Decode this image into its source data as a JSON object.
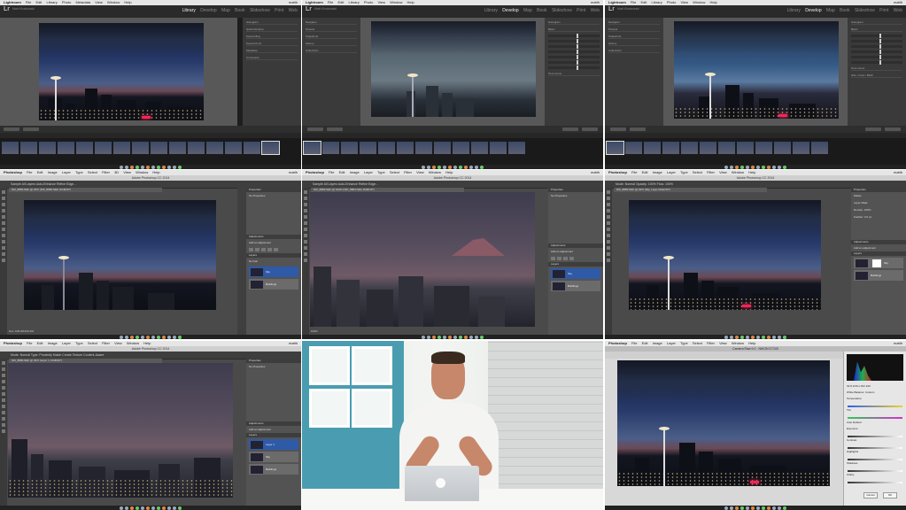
{
  "menubar": {
    "lightroom": {
      "app": "Lightroom",
      "items": [
        "File",
        "Edit",
        "Library",
        "Photo",
        "Metadata",
        "View",
        "Window",
        "Help"
      ]
    },
    "photoshop": {
      "app": "Photoshop",
      "items": [
        "File",
        "Edit",
        "Image",
        "Layer",
        "Type",
        "Select",
        "Filter",
        "3D",
        "View",
        "Window",
        "Help"
      ]
    },
    "clock": "matth"
  },
  "lightroom": {
    "logo": "Lr",
    "identity_plate": "Matt Kloskowski",
    "modules": [
      "Library",
      "Develop",
      "Map",
      "Book",
      "Slideshow",
      "Print",
      "Web"
    ],
    "library_active": "Library",
    "develop_active": "Develop",
    "left_panels": [
      "Navigator",
      "Presets",
      "Snapshots",
      "History",
      "Collections"
    ],
    "right_panels_library": [
      "Histogram",
      "Quick Develop",
      "Keywording",
      "Keyword List",
      "Metadata",
      "Comments"
    ],
    "right_panels_develop": [
      "Histogram",
      "Basic",
      "Tone Curve",
      "HSL / Color / B&W",
      "Split Toning",
      "Detail"
    ],
    "toolbar_buttons": [
      "Copy...",
      "Paste",
      "Previous",
      "Reset"
    ],
    "filmstrip_label": "Filter:"
  },
  "photoshop": {
    "window_title": "Adobe Photoshop CC 2014",
    "options_bar": "Sample All Layers   Auto-Enhance   Refine Edge...",
    "options_bar_2": "Mode: Normal   Opacity: 100%   Flow: 100%",
    "options_bar_3": "Mode: Normal   Type: Proximity Match   Create Texture   Content-Aware",
    "doc_tab_1": "NIK_8883.NEF @ 33% (NIK_8883.NEF, RGB/16*)",
    "doc_tab_2": "NIK_8883.NEF @ 100% (NIK_8883.NEF, RGB/16*)",
    "doc_tab_3": "NIK_8883.NEF @ 33% (Sky, Layer Mask/16*)",
    "doc_tab_4": "NIK_8883.NEF @ 33% (Layer 1, RGB/16*)",
    "properties_title": "Properties",
    "no_properties": "No Properties",
    "masks_label": "Masks",
    "layer_mask_label": "Layer Mask",
    "density_label": "Density:",
    "density_value": "100%",
    "feather_label": "Feather:",
    "feather_value": "0.0 px",
    "adjustments_title": "Adjustments",
    "add_adjustment": "Add an adjustment",
    "layers_title": "Layers",
    "blend_mode": "Normal",
    "opacity": "100%",
    "layer_sky": "Sky",
    "layer_buildings": "Buildings",
    "layer_1": "Layer 1",
    "status": "Doc: 108.2M/216.4M",
    "zoom_1": "33.33%",
    "zoom_2": "100%"
  },
  "camera_raw": {
    "title": "Camera Raw 9.0 - NIKON D7100",
    "readout": "f/2.8   1/30 s   ISO 100",
    "white_balance_label": "White Balance:",
    "white_balance_value": "Custom",
    "sliders": [
      "Temperature",
      "Tint",
      "Exposure",
      "Contrast",
      "Highlights",
      "Shadows",
      "Whites",
      "Blacks",
      "Clarity",
      "Vibrance",
      "Saturation"
    ],
    "auto": "Auto",
    "default": "Default",
    "cancel": "Cancel",
    "ok": "OK"
  }
}
